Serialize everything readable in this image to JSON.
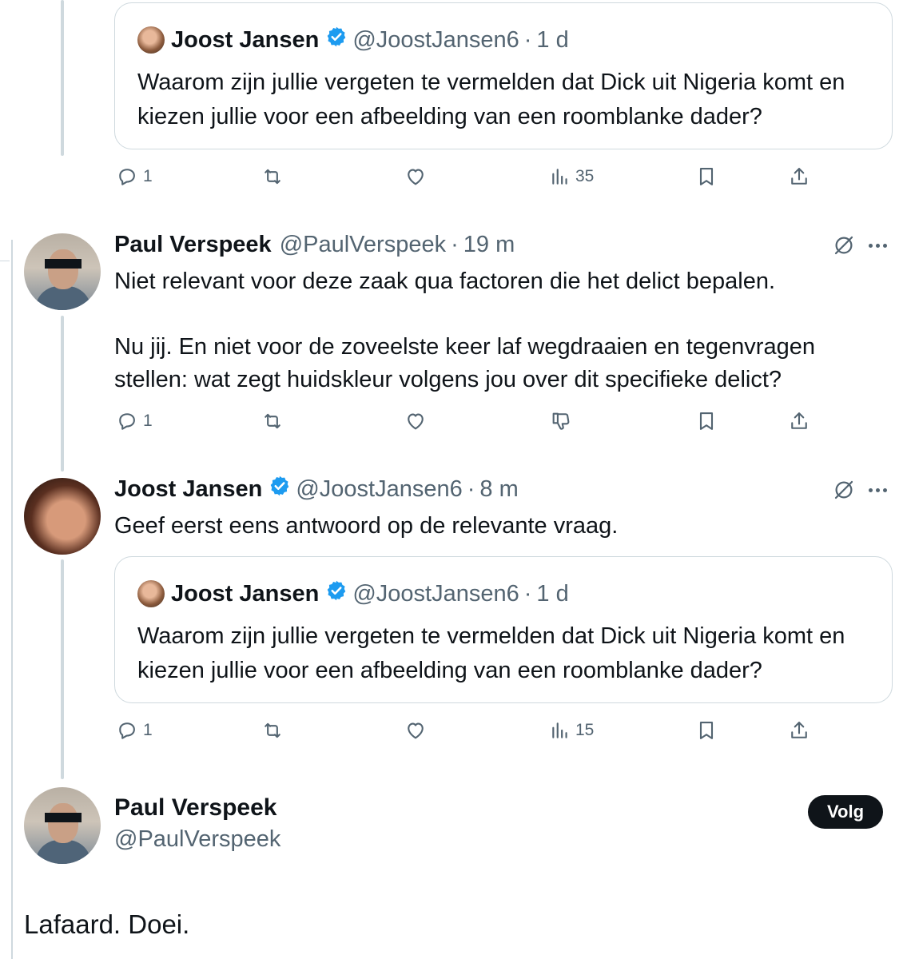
{
  "quote1": {
    "name": "Joost Jansen",
    "handle": "@JoostJansen6",
    "sep": "·",
    "time": "1 d",
    "text": "Waarom zijn jullie vergeten te vermelden dat Dick uit Nigeria komt en kiezen jullie voor een afbeelding van een roomblanke dader?"
  },
  "actions1": {
    "replies": "1",
    "views": "35"
  },
  "tweet2": {
    "name": "Paul Verspeek",
    "handle": "@PaulVerspeek",
    "sep": "·",
    "time": "19 m",
    "paragraph1": "Niet relevant voor deze zaak qua factoren die het delict bepalen.",
    "paragraph2": "Nu jij. En niet voor de zoveelste keer laf wegdraaien en tegenvragen stellen: wat zegt huidskleur volgens jou over dit specifieke delict?",
    "replies": "1"
  },
  "tweet3": {
    "name": "Joost Jansen",
    "handle": "@JoostJansen6",
    "sep": "·",
    "time": "8 m",
    "text": "Geef eerst eens antwoord op de relevante vraag.",
    "quote": {
      "name": "Joost Jansen",
      "handle": "@JoostJansen6",
      "sep": "·",
      "time": "1 d",
      "text": "Waarom zijn jullie vergeten te vermelden dat Dick uit Nigeria komt en kiezen jullie voor een afbeelding van een roomblanke dader?"
    },
    "replies": "1",
    "views": "15"
  },
  "main": {
    "name": "Paul Verspeek",
    "handle": "@PaulVerspeek",
    "follow_label": "Volg",
    "text": "Lafaard. Doei."
  },
  "colors": {
    "verified": "#1d9bf0",
    "muted": "#536471",
    "border": "#cfd9de"
  },
  "icons": [
    "verified-badge-icon",
    "reply-icon",
    "retweet-icon",
    "like-icon",
    "views-icon",
    "bookmark-icon",
    "share-icon",
    "dislike-icon",
    "grok-icon",
    "more-icon"
  ]
}
